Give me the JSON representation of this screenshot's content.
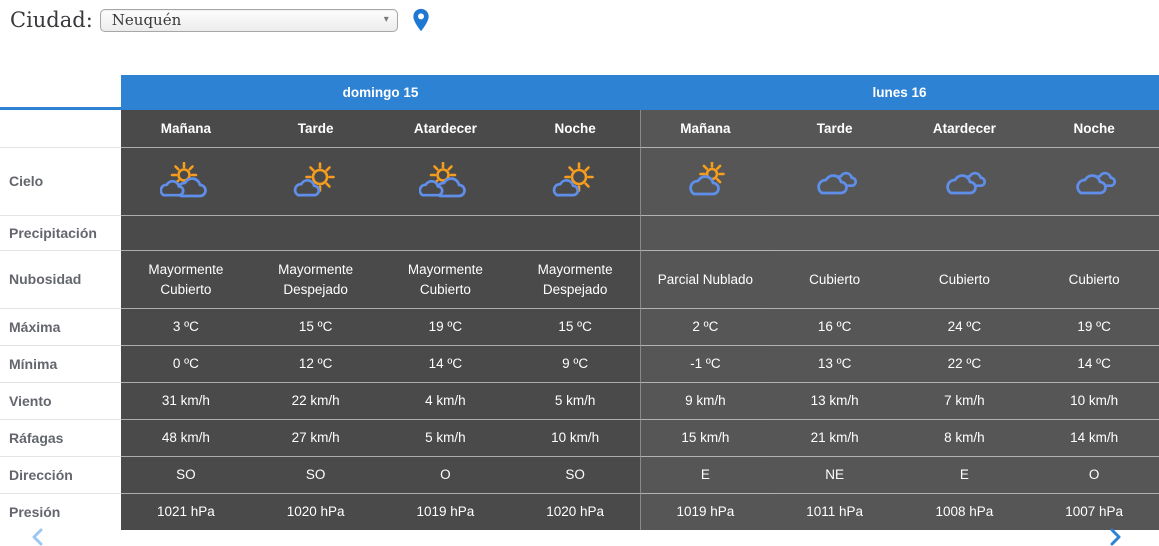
{
  "city_selector": {
    "label": "Ciudad:",
    "selected_city": "Neuquén",
    "dropdown_arrow": "▾"
  },
  "colors": {
    "accent_blue": "#2e82d4",
    "day1_background": "#4a4a4a",
    "day2_background": "#565656",
    "icon_sun_orange": "#f59d1d",
    "icon_cloud_blue": "#5f8fea",
    "pin_blue": "#1f78d1"
  },
  "table": {
    "days": [
      {
        "label": "domingo 15",
        "times": [
          "Mañana",
          "Tarde",
          "Atardecer",
          "Noche"
        ]
      },
      {
        "label": "lunes 16",
        "times": [
          "Mañana",
          "Tarde",
          "Atardecer",
          "Noche"
        ]
      }
    ],
    "rows": [
      {
        "label": "Cielo",
        "type": "icons",
        "values": [
          "mostly-cloudy",
          "mostly-clear",
          "mostly-cloudy",
          "mostly-clear",
          "partly-cloudy",
          "cloudy",
          "cloudy",
          "cloudy"
        ]
      },
      {
        "label": "Precipitación",
        "type": "text",
        "values": [
          "",
          "",
          "",
          "",
          "",
          "",
          "",
          ""
        ]
      },
      {
        "label": "Nubosidad",
        "type": "text",
        "values": [
          "Mayormente Cubierto",
          "Mayormente Despejado",
          "Mayormente Cubierto",
          "Mayormente Despejado",
          "Parcial Nublado",
          "Cubierto",
          "Cubierto",
          "Cubierto"
        ]
      },
      {
        "label": "Máxima",
        "type": "text",
        "values": [
          "3 ºC",
          "15 ºC",
          "19 ºC",
          "15 ºC",
          "2 ºC",
          "16 ºC",
          "24 ºC",
          "19 ºC"
        ]
      },
      {
        "label": "Mínima",
        "type": "text",
        "values": [
          "0 ºC",
          "12 ºC",
          "14 ºC",
          "9 ºC",
          "-1 ºC",
          "13 ºC",
          "22 ºC",
          "14 ºC"
        ]
      },
      {
        "label": "Viento",
        "type": "text",
        "values": [
          "31 km/h",
          "22 km/h",
          "4 km/h",
          "5 km/h",
          "9 km/h",
          "13 km/h",
          "7 km/h",
          "10 km/h"
        ]
      },
      {
        "label": "Ráfagas",
        "type": "text",
        "values": [
          "48 km/h",
          "27 km/h",
          "5 km/h",
          "10 km/h",
          "15 km/h",
          "21 km/h",
          "8 km/h",
          "14 km/h"
        ]
      },
      {
        "label": "Dirección",
        "type": "text",
        "values": [
          "SO",
          "SO",
          "O",
          "SO",
          "E",
          "NE",
          "E",
          "O"
        ]
      },
      {
        "label": "Presión",
        "type": "text",
        "values": [
          "1021 hPa",
          "1020 hPa",
          "1019 hPa",
          "1020 hPa",
          "1019 hPa",
          "1011 hPa",
          "1008 hPa",
          "1007 hPa"
        ]
      }
    ]
  }
}
